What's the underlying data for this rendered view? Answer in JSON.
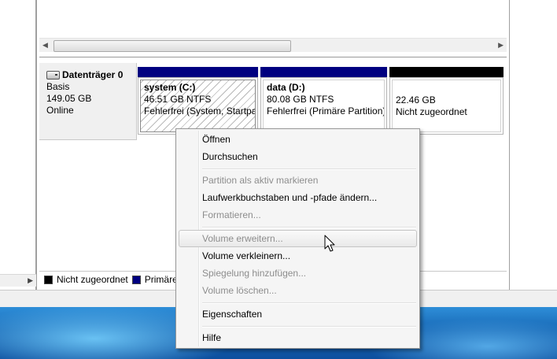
{
  "disk": {
    "name": "Datenträger 0",
    "type": "Basis",
    "size": "149.05 GB",
    "status": "Online"
  },
  "partitions": [
    {
      "name": "system  (C:)",
      "size": "46.51 GB NTFS",
      "status": "Fehlerfrei (System, Startpar",
      "color": "#000080"
    },
    {
      "name": "data  (D:)",
      "size": "80.08 GB NTFS",
      "status": "Fehlerfrei (Primäre Partition)",
      "color": "#000080"
    },
    {
      "name": "",
      "size": "22.46 GB",
      "status": "Nicht zugeordnet",
      "color": "#000000"
    }
  ],
  "legend": [
    {
      "label": "Nicht zugeordnet",
      "color": "#000000"
    },
    {
      "label": "Primäre",
      "color": "#000080"
    }
  ],
  "context_menu": {
    "items": [
      {
        "label": "Öffnen",
        "enabled": true
      },
      {
        "label": "Durchsuchen",
        "enabled": true
      },
      {
        "label": "Partition als aktiv markieren",
        "enabled": false
      },
      {
        "label": "Laufwerkbuchstaben und -pfade ändern...",
        "enabled": true
      },
      {
        "label": "Formatieren...",
        "enabled": false
      },
      {
        "label": "Volume erweitern...",
        "enabled": false,
        "highlighted": true
      },
      {
        "label": "Volume verkleinern...",
        "enabled": true
      },
      {
        "label": "Spiegelung hinzufügen...",
        "enabled": false
      },
      {
        "label": "Volume löschen...",
        "enabled": false
      },
      {
        "label": "Eigenschaften",
        "enabled": true
      },
      {
        "label": "Hilfe",
        "enabled": true
      }
    ]
  },
  "icons": {
    "disk": "hard-disk-icon",
    "cursor": "mouse-pointer-icon",
    "scroll_left": "chevron-left-icon",
    "scroll_right": "chevron-right-icon"
  },
  "colors": {
    "primary_partition": "#000080",
    "unallocated": "#000000",
    "taskbar": "#1767b5"
  }
}
